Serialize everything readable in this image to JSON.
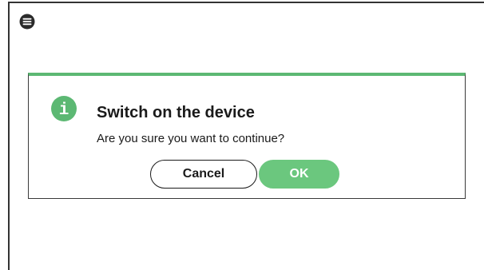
{
  "app": {
    "menu_icon": "hamburger-menu-icon"
  },
  "dialog": {
    "icon": "info-icon",
    "icon_glyph": "i",
    "title": "Switch on the device",
    "message": "Are you sure you want to continue?",
    "cancel_label": "Cancel",
    "ok_label": "OK",
    "accent_color": "#5cb873",
    "ok_color": "#6bc77e"
  }
}
